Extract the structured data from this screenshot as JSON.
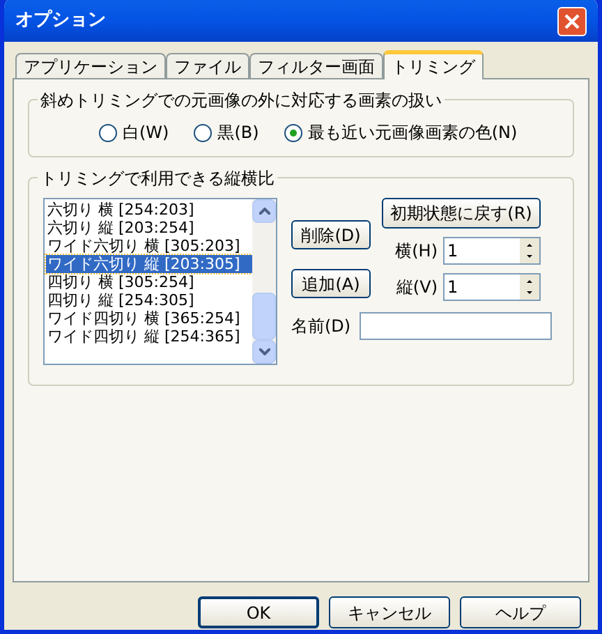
{
  "window": {
    "title": "オプション"
  },
  "tabs": [
    {
      "label": "アプリケーション",
      "selected": false
    },
    {
      "label": "ファイル",
      "selected": false
    },
    {
      "label": "フィルター画面",
      "selected": false
    },
    {
      "label": "トリミング",
      "selected": true
    }
  ],
  "outside_group": {
    "title": "斜めトリミングでの元画像の外に対応する画素の扱い",
    "options": [
      {
        "label": "白(W)",
        "selected": false
      },
      {
        "label": "黒(B)",
        "selected": false
      },
      {
        "label": "最も近い元画像画素の色(N)",
        "selected": true
      }
    ]
  },
  "ratio_group": {
    "title": "トリミングで利用できる縦横比",
    "list": [
      {
        "label": "六切り 横 [254:203]",
        "selected": false
      },
      {
        "label": "六切り 縦 [203:254]",
        "selected": false
      },
      {
        "label": "ワイド六切り 横 [305:203]",
        "selected": false
      },
      {
        "label": "ワイド六切り 縦 [203:305]",
        "selected": true
      },
      {
        "label": "四切り 横 [305:254]",
        "selected": false
      },
      {
        "label": "四切り 縦 [254:305]",
        "selected": false
      },
      {
        "label": "ワイド四切り 横 [365:254]",
        "selected": false
      },
      {
        "label": "ワイド四切り 縦 [254:365]",
        "selected": false
      }
    ],
    "delete_button": "削除(D)",
    "add_button": "追加(A)",
    "reset_button": "初期状態に戻す(R)",
    "width_label": "横(H)",
    "width_value": "1",
    "height_label": "縦(V)",
    "height_value": "1",
    "name_label": "名前(D)"
  },
  "buttons": [
    "OK",
    "キャンセル",
    "ヘルプ"
  ]
}
